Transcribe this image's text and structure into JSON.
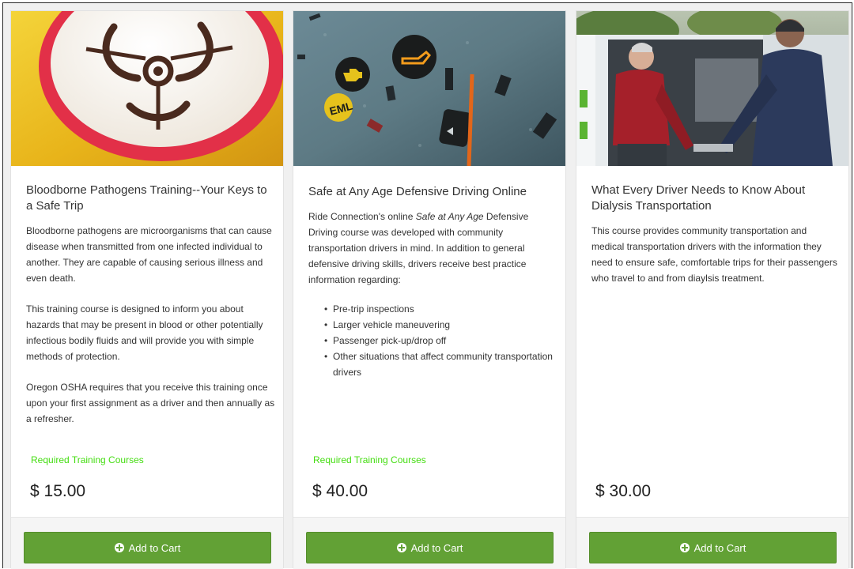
{
  "cards": [
    {
      "title": "Bloodborne Pathogens Training--Your Keys to a Safe Trip",
      "image_icon": "biohazard-sign",
      "paragraphs": [
        "Bloodborne pathogens are microorganisms that can cause disease when transmitted from one infected individual to another.  They are capable of causing serious illness and even death.",
        "This training course is designed to inform you about hazards that may be present in blood or other potentially infectious bodily fluids and will provide you with simple methods of protection.",
        "Oregon OSHA requires that you receive this training once upon your first assignment as a driver and then annually as a refresher."
      ],
      "category": "Required Training Courses",
      "price": "$ 15.00",
      "button_label": "Add to Cart"
    },
    {
      "title": "Safe at Any Age Defensive Driving Online",
      "image_icon": "dashboard-warning-lights",
      "intro_before": "Ride Connection's online ",
      "intro_emphasis": "Safe at Any Age",
      "intro_after": " Defensive Driving course was developed with community transportation drivers in mind. In addition to general defensive driving skills, drivers receive best practice information regarding:",
      "list": [
        "Pre-trip inspections",
        "Larger vehicle maneuvering",
        "Passenger pick-up/drop off",
        "Other situations that affect community transportation drivers"
      ],
      "category": "Required Training Courses",
      "price": "$ 40.00",
      "button_label": "Add to Cart"
    },
    {
      "title": "What Every Driver Needs to Know About Dialysis Transportation",
      "image_icon": "driver-assisting-passenger-photo",
      "paragraphs": [
        "This course provides community transportation and medical transportation drivers with the information they need to ensure safe, comfortable trips for their passengers who travel to and from diaylsis treatment."
      ],
      "price": "$ 30.00",
      "button_label": "Add to Cart"
    }
  ],
  "colors": {
    "button": "#62a135",
    "category": "#44dd11",
    "page_background": "#f0f0f0"
  }
}
